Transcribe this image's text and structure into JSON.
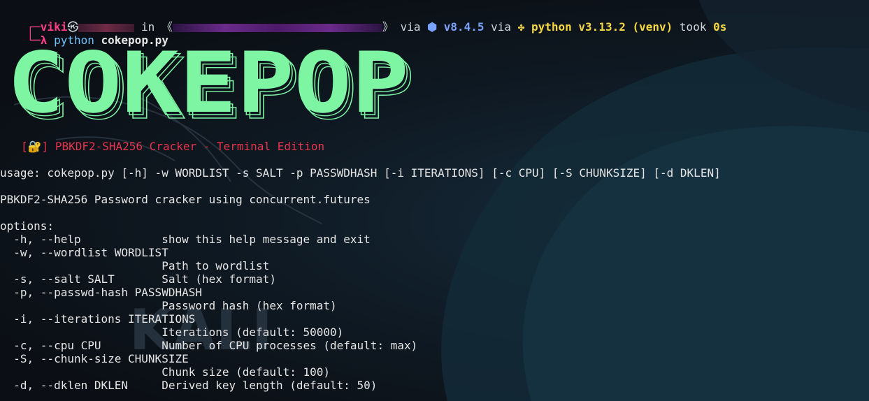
{
  "prompt": {
    "user": "viki",
    "host_sep": "㉿",
    "in_label": "in",
    "path_open": "《",
    "path_close": "》",
    "via1": "via",
    "node_icon": "⬢",
    "node_version": "v8.4.5",
    "via2": "via",
    "python_icon": "✤",
    "python_version": "python v3.13.2 (venv)",
    "took_label": "took",
    "took_value": "0s"
  },
  "command": {
    "lambda": "λ",
    "program": "python",
    "script": "cokepop.py"
  },
  "banner": {
    "logo_text": "COKEPOP",
    "title": "[🔐] PBKDF2-SHA256 Cracker - Terminal Edition"
  },
  "help": {
    "usage": "usage: cokepop.py [-h] -w WORDLIST -s SALT -p PASSWDHASH [-i ITERATIONS] [-c CPU] [-S CHUNKSIZE] [-d DKLEN]",
    "description": "PBKDF2-SHA256 Password cracker using concurrent.futures",
    "options_header": "options:",
    "lines": [
      "  -h, --help            show this help message and exit",
      "  -w, --wordlist WORDLIST",
      "                        Path to wordlist",
      "  -s, --salt SALT       Salt (hex format)",
      "  -p, --passwd-hash PASSWDHASH",
      "                        Password hash (hex format)",
      "  -i, --iterations ITERATIONS",
      "                        Iterations (default: 50000)",
      "  -c, --cpu CPU         Number of CPU processes (default: max)",
      "  -S, --chunk-size CHUNKSIZE",
      "                        Chunk size (default: 100)",
      "  -d, --dklen DKLEN     Derived key length (default: 50)"
    ]
  },
  "colors": {
    "accent_pink": "#ff3d8b",
    "logo_green": "#7df5a3",
    "title_red": "#e8344d",
    "command_blue": "#6fc3ff",
    "version_yellow": "#f5d742"
  }
}
